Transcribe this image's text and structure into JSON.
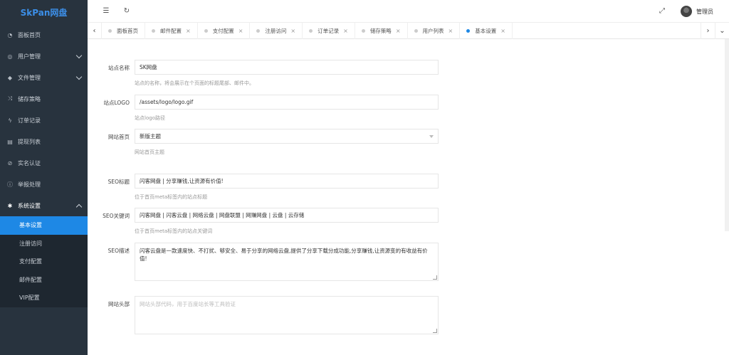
{
  "app": {
    "title": "SkPan网盘"
  },
  "sidebar": {
    "items": [
      {
        "label": "面板首页",
        "icon": "dashboard-icon"
      },
      {
        "label": "用户管理",
        "icon": "user-icon"
      },
      {
        "label": "文件管理",
        "icon": "folder-icon"
      },
      {
        "label": "储存策略",
        "icon": "storage-icon"
      },
      {
        "label": "订单记录",
        "icon": "order-icon"
      },
      {
        "label": "提现列表",
        "icon": "withdraw-icon"
      },
      {
        "label": "实名认证",
        "icon": "verify-icon"
      },
      {
        "label": "举报处理",
        "icon": "report-icon"
      },
      {
        "label": "系统设置",
        "icon": "gear-icon"
      }
    ],
    "sub_items": [
      {
        "label": "基本设置"
      },
      {
        "label": "注册访问"
      },
      {
        "label": "支付配置"
      },
      {
        "label": "邮件配置"
      },
      {
        "label": "VIP配置"
      }
    ]
  },
  "header": {
    "user_name": "管理员"
  },
  "tabs": [
    {
      "label": "面板首页"
    },
    {
      "label": "邮件配置"
    },
    {
      "label": "支付配置"
    },
    {
      "label": "注册访问"
    },
    {
      "label": "订单记录"
    },
    {
      "label": "储存策略"
    },
    {
      "label": "用户列表"
    },
    {
      "label": "基本设置"
    }
  ],
  "form": {
    "site_name": {
      "label": "站点名称",
      "value": "SK网盘",
      "hint": "站点的名称，将会展示在个页面的标题尾部、邮件中。"
    },
    "site_logo": {
      "label": "站点LOGO",
      "value": "/assets/logo/logo.gif",
      "hint": "站点logo路径"
    },
    "home_page": {
      "label": "网站首页",
      "value": "新版主题",
      "hint": "网站首页主题"
    },
    "seo_title": {
      "label": "SEO标题",
      "value": "闪客网盘 | 分享赚钱,让资源有价值!",
      "hint": "位于首页meta标签内的站点标题"
    },
    "seo_keywords": {
      "label": "SEO关键词",
      "value": "闪客网盘 | 闪客云盘 | 网络云盘 | 网盘联盟 | 网赚网盘 | 云盘 | 云存储",
      "hint": "位于首页meta标签内的站点关键词"
    },
    "seo_desc": {
      "label": "SEO描述",
      "value": "闪客云盘是一款速度快、不打扰、够安全、易于分享的网络云盘,提供了分享下载分成功能,分享赚钱,让资源变的有收益有价值!"
    },
    "site_header": {
      "label": "网站头部",
      "placeholder": "网站头部代码，用于百度站长等工具验证"
    }
  }
}
